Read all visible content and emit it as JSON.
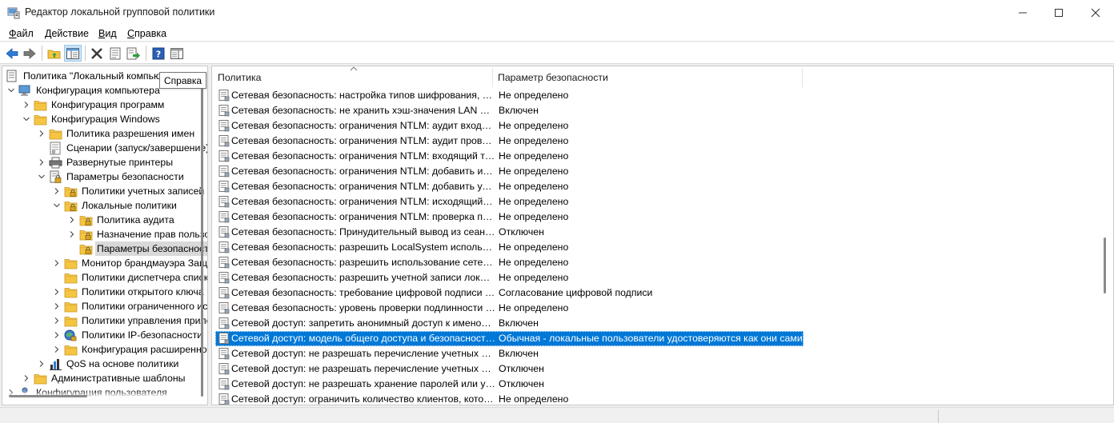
{
  "window": {
    "title": "Редактор локальной групповой политики",
    "controls": [
      "minimize-icon",
      "maximize-icon",
      "close-icon"
    ]
  },
  "menu": {
    "items": [
      {
        "label": "Файл",
        "mnemonic": "Ф"
      },
      {
        "label": "Действие",
        "mnemonic": "Д"
      },
      {
        "label": "Вид",
        "mnemonic": "В"
      },
      {
        "label": "Справка",
        "mnemonic": "С"
      }
    ]
  },
  "toolbar": {
    "buttons": [
      "back-arrow-icon",
      "forward-arrow-icon",
      "up-folder-icon",
      "show-hide-tree-icon",
      "delete-icon",
      "properties-icon",
      "export-list-icon",
      "help-icon",
      "show-action-pane-icon"
    ],
    "tooltip": "Справка"
  },
  "tree": {
    "items": [
      {
        "label": "Политика \"Локальный компьютер\"",
        "level": 0,
        "chevron": "none",
        "icon": "computer-policy-icon"
      },
      {
        "label": "Конфигурация компьютера",
        "level": 0,
        "chevron": "down",
        "icon": "computer-icon"
      },
      {
        "label": "Конфигурация программ",
        "level": 1,
        "chevron": "right",
        "icon": "folder-icon"
      },
      {
        "label": "Конфигурация Windows",
        "level": 1,
        "chevron": "down",
        "icon": "folder-icon"
      },
      {
        "label": "Политика разрешения имен",
        "level": 2,
        "chevron": "right",
        "icon": "folder-icon"
      },
      {
        "label": "Сценарии (запуск/завершение)",
        "level": 2,
        "chevron": "none",
        "icon": "script-icon"
      },
      {
        "label": "Развернутые принтеры",
        "level": 2,
        "chevron": "right",
        "icon": "printer-icon"
      },
      {
        "label": "Параметры безопасности",
        "level": 2,
        "chevron": "down",
        "icon": "security-settings-icon"
      },
      {
        "label": "Политики учетных записей",
        "level": 3,
        "chevron": "right",
        "icon": "locked-folder-icon"
      },
      {
        "label": "Локальные политики",
        "level": 3,
        "chevron": "down",
        "icon": "locked-folder-icon"
      },
      {
        "label": "Политика аудита",
        "level": 4,
        "chevron": "right",
        "icon": "locked-folder-icon"
      },
      {
        "label": "Назначение прав пользователя",
        "level": 4,
        "chevron": "right",
        "icon": "locked-folder-icon"
      },
      {
        "label": "Параметры безопасности",
        "level": 4,
        "chevron": "none",
        "icon": "locked-folder-icon",
        "selected": true
      },
      {
        "label": "Монитор брандмауэра Защитника Windows",
        "level": 3,
        "chevron": "right",
        "icon": "folder-icon"
      },
      {
        "label": "Политики диспетчера списка сетей",
        "level": 3,
        "chevron": "none",
        "icon": "folder-icon"
      },
      {
        "label": "Политики открытого ключа",
        "level": 3,
        "chevron": "right",
        "icon": "folder-icon"
      },
      {
        "label": "Политики ограниченного использования программ",
        "level": 3,
        "chevron": "right",
        "icon": "folder-icon"
      },
      {
        "label": "Политики управления приложениями",
        "level": 3,
        "chevron": "right",
        "icon": "folder-icon"
      },
      {
        "label": "Политики IP-безопасности",
        "level": 3,
        "chevron": "right",
        "icon": "ip-security-icon"
      },
      {
        "label": "Конфигурация расширенной политики аудита",
        "level": 3,
        "chevron": "right",
        "icon": "folder-icon"
      },
      {
        "label": "QoS на основе политики",
        "level": 2,
        "chevron": "right",
        "icon": "qos-chart-icon"
      },
      {
        "label": "Административные шаблоны",
        "level": 1,
        "chevron": "right",
        "icon": "folder-icon"
      },
      {
        "label": "Конфигурация пользователя",
        "level": 0,
        "chevron": "right",
        "icon": "user-icon"
      }
    ]
  },
  "list": {
    "columns": [
      "Политика",
      "Параметр безопасности"
    ],
    "rows": [
      {
        "policy": "Сетевая безопасность: настройка типов шифрования, разрешенных для Kerberos",
        "value": "Не определено"
      },
      {
        "policy": "Сетевая безопасность: не хранить хэш-значения LAN Manager при следующей смене пароля",
        "value": "Включен"
      },
      {
        "policy": "Сетевая безопасность: ограничения NTLM: аудит входящего трафика NTLM",
        "value": "Не определено"
      },
      {
        "policy": "Сетевая безопасность: ограничения NTLM: аудит проверки подлинности NTLM в этом домене",
        "value": "Не определено"
      },
      {
        "policy": "Сетевая безопасность: ограничения NTLM: входящий трафик NTLM",
        "value": "Не определено"
      },
      {
        "policy": "Сетевая безопасность: ограничения NTLM: добавить исключения для серверов в этом домене",
        "value": "Не определено"
      },
      {
        "policy": "Сетевая безопасность: ограничения NTLM: добавить удаленные серверы в исключения",
        "value": "Не определено"
      },
      {
        "policy": "Сетевая безопасность: ограничения NTLM: исходящий трафик NTLM к удаленным серверам",
        "value": "Не определено"
      },
      {
        "policy": "Сетевая безопасность: ограничения NTLM: проверка подлинности NTLM в этом домене",
        "value": "Не определено"
      },
      {
        "policy": "Сетевая безопасность: Принудительный вывод из сеанса по истечении допустимых часов работы",
        "value": "Отключен"
      },
      {
        "policy": "Сетевая безопасность: разрешить LocalSystem использовать удостоверение компьютера для NTLM",
        "value": "Не определено"
      },
      {
        "policy": "Сетевая безопасность: разрешить использование сетевых удостоверений в запросах PKU2U",
        "value": "Не определено"
      },
      {
        "policy": "Сетевая безопасность: разрешить учетной записи локальной системы пустые сеансы",
        "value": "Не определено"
      },
      {
        "policy": "Сетевая безопасность: требование цифровой подписи для клиента LDAP",
        "value": "Согласование цифровой подписи"
      },
      {
        "policy": "Сетевая безопасность: уровень проверки подлинности LAN Manager",
        "value": "Не определено"
      },
      {
        "policy": "Сетевой доступ: запретить анонимный доступ к именованным каналам и общим ресурсам",
        "value": "Включен"
      },
      {
        "policy": "Сетевой доступ: модель общего доступа и безопасности для локальных учетных записей",
        "value": "Обычная - локальные пользователи удостоверяются как они сами",
        "selected": true
      },
      {
        "policy": "Сетевой доступ: не разрешать перечисление учетных записей SAM анонимными пользователями",
        "value": "Включен"
      },
      {
        "policy": "Сетевой доступ: не разрешать перечисление учетных записей SAM и общих ресурсов",
        "value": "Отключен"
      },
      {
        "policy": "Сетевой доступ: не разрешать хранение паролей или учетных данных для сетевой проверки",
        "value": "Отключен"
      },
      {
        "policy": "Сетевой доступ: ограничить количество клиентов, которым разрешено удаленно вызывать SAM",
        "value": "Не определено"
      }
    ]
  },
  "colors": {
    "selection": "#0078d7",
    "tree_selection": "#d9d9d9",
    "folder": "#f5c542",
    "help_blue": "#2b5fb4"
  }
}
